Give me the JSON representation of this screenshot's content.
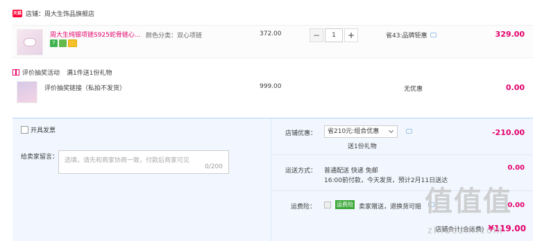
{
  "shop": {
    "badge": "天猫",
    "name": "店铺：周大生饰品旗舰店"
  },
  "item": {
    "title": "周大生纯银项链S925蛇骨链心...",
    "sku": "颜色分类：双心项链",
    "price": "372.00",
    "qty": "1",
    "qty_minus": "−",
    "qty_plus": "+",
    "discount": "省43:品牌钜惠",
    "total": "329.00",
    "service_icon_1": "7"
  },
  "gift": {
    "activity": "评价抽奖活动",
    "rule": "满1件送1份礼物",
    "title": "评价抽奖链接（私拍不发货）",
    "price": "999.00",
    "discount": "无优惠",
    "total": "0.00"
  },
  "summary": {
    "invoice_label": "开具发票",
    "note_label": "给卖家留言：",
    "note_placeholder": "选填，请先和商家协商一致，付款后商家可见",
    "note_count": "0/200",
    "coupon_label": "店铺优惠：",
    "coupon_value": "省210元:组合优惠",
    "coupon_sub": "送1份礼物",
    "coupon_amount": "-210.00",
    "shipping_label": "运送方式：",
    "shipping_line1": "普通配送 快递 免邮",
    "shipping_line2": "16:00前付款，今天发货，预计2月11日送达",
    "shipping_amount": "0.00",
    "insurance_label": "运费险：",
    "insurance_tag": "运费险",
    "insurance_text": "卖家赠送，退换货可赔",
    "insurance_amount": "0.00",
    "total_label": "店铺合计(含运费)",
    "total_value": "¥119.00"
  },
  "watermark": {
    "text": "值值值",
    "url": "zhidezhi.com"
  },
  "colors": {
    "accent": "#e4006b",
    "tmall": "#ff0036",
    "summary_bg": "#f2f7ff"
  }
}
